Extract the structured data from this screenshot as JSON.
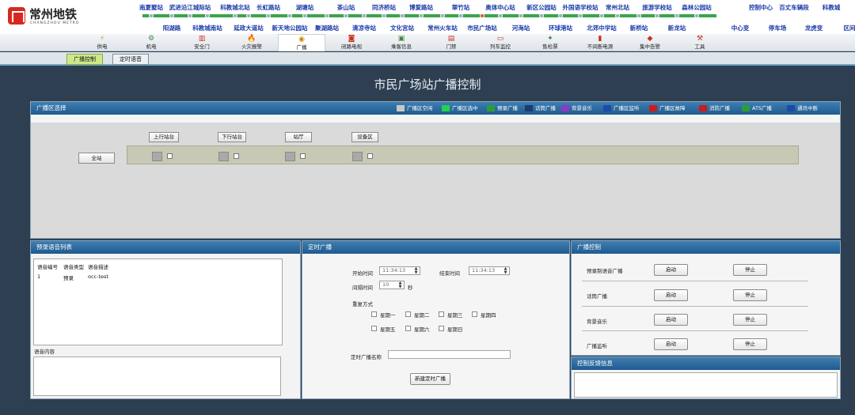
{
  "logo": {
    "cn": "常州地铁",
    "en": "CHANGZHOU METRO",
    "brand_color": "#d8281e"
  },
  "line_map": {
    "stations_top": [
      "南夏墅站",
      "武进沿江城际站",
      "科教城北站",
      "长虹路站",
      "湖塘站",
      "茶山站",
      "同济桥站",
      "博爱路站",
      "翠竹站",
      "奥体中心站",
      "新区公园站",
      "外国语学校站",
      "常州北站",
      "旅游学校站",
      "森林公园站"
    ],
    "stations_bottom": [
      "阳湖路",
      "科教城南站",
      "延政大道站",
      "新天地公园站",
      "聚湖路站",
      "清凉寺站",
      "文化宫站",
      "常州火车站",
      "市民广场站",
      "河海站",
      "环球港站",
      "北郊中学站",
      "新桥站",
      "新龙站"
    ],
    "right_top": [
      "控制中心",
      "百丈车辆段",
      "科教城"
    ],
    "right_bottom": [
      "中心变",
      "停车场",
      "龙虎变",
      "区间"
    ],
    "current_station": "市民广场站",
    "line_color": "#3aa44b"
  },
  "toolbar": {
    "items": [
      {
        "label": "供电",
        "icon": "lightning-icon",
        "glyph": "⚡",
        "color": "#e0a100"
      },
      {
        "label": "机电",
        "icon": "gear-icon",
        "glyph": "⚙",
        "color": "#3a8a3a"
      },
      {
        "label": "安全门",
        "icon": "door-icon",
        "glyph": "▥",
        "color": "#c8321e"
      },
      {
        "label": "火灾报警",
        "icon": "fire-icon",
        "glyph": "🔥",
        "color": "#e0501e"
      },
      {
        "label": "广播",
        "icon": "speaker-icon",
        "glyph": "◉",
        "color": "#c88a00"
      },
      {
        "label": "闭路电视",
        "icon": "camera-icon",
        "glyph": "◙",
        "color": "#c8321e"
      },
      {
        "label": "乘客信息",
        "icon": "monitor-icon",
        "glyph": "▣",
        "color": "#3a8a3a"
      },
      {
        "label": "门禁",
        "icon": "lock-icon",
        "glyph": "▤",
        "color": "#c8321e"
      },
      {
        "label": "列车监控",
        "icon": "train-icon",
        "glyph": "▭",
        "color": "#c8321e"
      },
      {
        "label": "售检票",
        "icon": "ticket-icon",
        "glyph": "✦",
        "color": "#3a8a3a"
      },
      {
        "label": "不间断电源",
        "icon": "ups-icon",
        "glyph": "▮",
        "color": "#c8321e"
      },
      {
        "label": "集中告警",
        "icon": "alarm-icon",
        "glyph": "◆",
        "color": "#c8321e"
      },
      {
        "label": "工具",
        "icon": "tool-icon",
        "glyph": "⚒",
        "color": "#c8321e"
      }
    ],
    "active": "广播"
  },
  "tabs": [
    "广播控制",
    "定时语音"
  ],
  "page_title": "市民广场站广播控制",
  "zone_panel": {
    "title": "广播区选择",
    "legend": [
      {
        "label": "广播区空闲",
        "color": "#c8c8c8"
      },
      {
        "label": "广播区选中",
        "color": "#22d24a"
      },
      {
        "label": "预录广播",
        "color": "#2e9b3a"
      },
      {
        "label": "话筒广播",
        "color": "#1e3a6e"
      },
      {
        "label": "背景音乐",
        "color": "#8a3ac8"
      },
      {
        "label": "广播区监听",
        "color": "#1e4aa8"
      },
      {
        "label": "广播区故障",
        "color": "#c81e1e"
      },
      {
        "label": "消防广播",
        "color": "#c81e1e"
      },
      {
        "label": "ATS广播",
        "color": "#2e9b3a"
      },
      {
        "label": "通讯中断",
        "color": "#1e4aa8"
      }
    ],
    "all_button": "全站",
    "zones": [
      "上行站台",
      "下行站台",
      "站厅",
      "设备区"
    ]
  },
  "list_panel": {
    "title": "预录语音列表",
    "columns": [
      "语音编号",
      "语音类型",
      "语音描述"
    ],
    "rows": [
      [
        "1",
        "预录",
        "occ-test"
      ]
    ],
    "content_label": "语音内容"
  },
  "sched_panel": {
    "title": "定时广播",
    "start_label": "开始时间",
    "start_value": "11:34:13",
    "end_label": "结束时间",
    "end_value": "11:34:13",
    "interval_label": "间隔时间",
    "interval_value": "10",
    "interval_unit": "秒",
    "repeat_label": "重复方式",
    "days_row1": [
      "星期一",
      "星期二",
      "星期三",
      "星期四"
    ],
    "days_row2": [
      "星期五",
      "星期六",
      "星期日"
    ],
    "name_label": "定时广播名称",
    "name_value": "",
    "create_button": "新建定时广播"
  },
  "ctrl_panel": {
    "title": "广播控制",
    "rows": [
      {
        "label": "预录制语音广播",
        "start": "启动",
        "stop": "停止"
      },
      {
        "label": "话筒广播",
        "start": "启动",
        "stop": "停止"
      },
      {
        "label": "背景音乐",
        "start": "启动",
        "stop": "停止"
      },
      {
        "label": "广播监听",
        "start": "启动",
        "stop": "停止"
      }
    ]
  },
  "feedback_panel": {
    "title": "控制反馈信息"
  }
}
